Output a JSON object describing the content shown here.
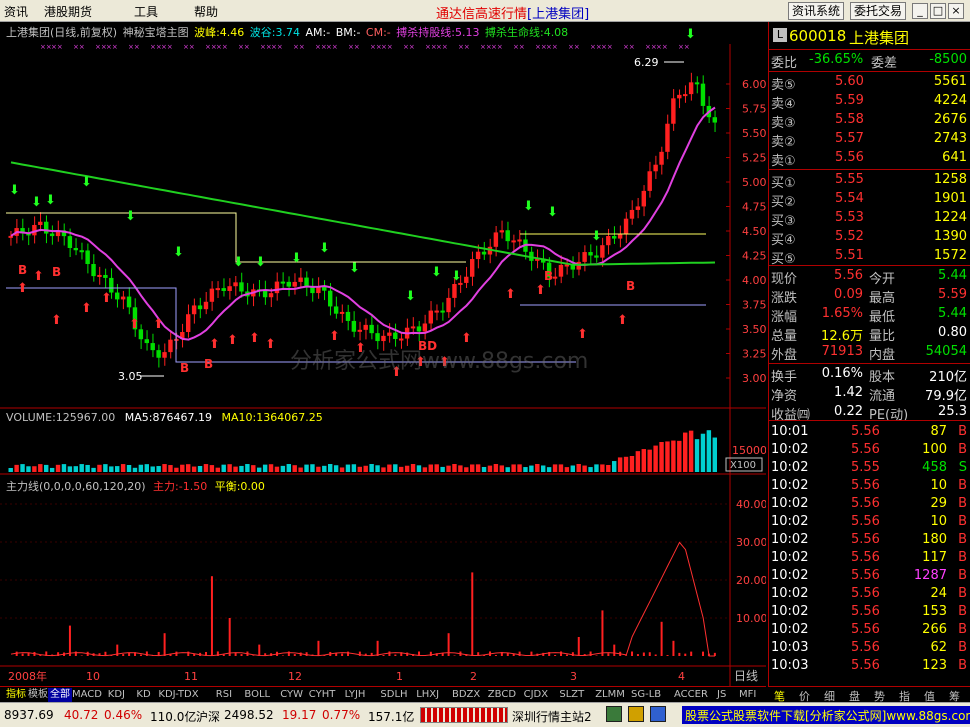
{
  "menu": {
    "items": [
      "资讯",
      "港股期货",
      "工具",
      "帮助"
    ],
    "app_title_prefix": "通达信高速行情",
    "app_title_stock": "[上港集团]",
    "btn_info": "资讯系统",
    "btn_trade": "委托交易"
  },
  "chart_header": {
    "stock": "上港集团(日线,前复权)",
    "indicator": "神秘宝塔主图",
    "peak_label": "波峰:4.46",
    "valley_label": "波谷:3.74",
    "am": "AM:-",
    "bm": "BM:-",
    "cm": "CM:-",
    "hold_line": "搏杀持股线:5.13",
    "life_line": "搏杀生命线:4.08"
  },
  "price_axis": [
    "6.00",
    "5.75",
    "5.50",
    "5.25",
    "5.00",
    "4.75",
    "4.50",
    "4.25",
    "4.00",
    "3.75",
    "3.50",
    "3.25",
    "3.00"
  ],
  "annotations": {
    "high": "6.29",
    "low": "3.05",
    "watermark": "分析家公式网www.88gs.com"
  },
  "volume_header": {
    "label": "VOLUME:125967.00",
    "ma5": "MA5:876467.19",
    "ma10": "MA10:1364067.25"
  },
  "volume_axis": {
    "v": "15000",
    "unit": "X100"
  },
  "main_force_header": {
    "label": "主力线(0,0,0,0,60,120,20)",
    "main": "主力:-1.50",
    "balance": "平衡:0.00"
  },
  "mf_axis": [
    "40.00",
    "30.00",
    "20.00",
    "10.00"
  ],
  "date_axis": [
    "2008年",
    "10",
    "11",
    "12",
    "1",
    "2",
    "3",
    "4"
  ],
  "date_axis_tag": "日线",
  "tabs": [
    "指标",
    "模板",
    "全部",
    "MACD",
    "KDJ",
    "KD",
    "KDJ-TDX",
    "RSI",
    "BOLL",
    "CYW",
    "CYHT",
    "LYJH",
    "SDLH",
    "LHXJ",
    "BDZX",
    "ZBCD",
    "CJDX",
    "SLZT",
    "ZLMM",
    "SG-LB",
    "ACCER",
    "JS",
    "MFI"
  ],
  "quote": {
    "code": "600018",
    "name": "上港集团",
    "wb_label": "委比",
    "wb_value": "-36.65%",
    "wc_label": "委差",
    "wc_value": "-8500",
    "asks": [
      {
        "label": "卖⑤",
        "price": "5.60",
        "vol": "5561"
      },
      {
        "label": "卖④",
        "price": "5.59",
        "vol": "4224"
      },
      {
        "label": "卖③",
        "price": "5.58",
        "vol": "2676"
      },
      {
        "label": "卖②",
        "price": "5.57",
        "vol": "2743"
      },
      {
        "label": "卖①",
        "price": "5.56",
        "vol": "641"
      }
    ],
    "bids": [
      {
        "label": "买①",
        "price": "5.55",
        "vol": "1258"
      },
      {
        "label": "买②",
        "price": "5.54",
        "vol": "1901"
      },
      {
        "label": "买③",
        "price": "5.53",
        "vol": "1224"
      },
      {
        "label": "买④",
        "price": "5.52",
        "vol": "1390"
      },
      {
        "label": "买⑤",
        "price": "5.51",
        "vol": "1572"
      }
    ],
    "stats": [
      {
        "l1": "现价",
        "v1": "5.56",
        "l2": "今开",
        "v2": "5.44",
        "c1": "#ff3030",
        "c2": "#00e000"
      },
      {
        "l1": "涨跌",
        "v1": "0.09",
        "l2": "最高",
        "v2": "5.59",
        "c1": "#ff3030",
        "c2": "#ff3030"
      },
      {
        "l1": "涨幅",
        "v1": "1.65%",
        "l2": "最低",
        "v2": "5.44",
        "c1": "#ff3030",
        "c2": "#00e000"
      },
      {
        "l1": "总量",
        "v1": "12.6万",
        "l2": "量比",
        "v2": "0.80",
        "c1": "#ffff00",
        "c2": "#ffffff"
      },
      {
        "l1": "外盘",
        "v1": "71913",
        "l2": "内盘",
        "v2": "54054",
        "c1": "#ff3030",
        "c2": "#00e000"
      }
    ],
    "fin": [
      {
        "l1": "换手",
        "v1": "0.16%",
        "l2": "股本",
        "v2": "210亿"
      },
      {
        "l1": "净资",
        "v1": "1.42",
        "l2": "流通",
        "v2": "79.9亿"
      },
      {
        "l1": "收益㈣",
        "v1": "0.22",
        "l2": "PE(动)",
        "v2": "25.3"
      }
    ],
    "ticks": [
      {
        "t": "10:01",
        "p": "5.56",
        "v": "87",
        "s": "B"
      },
      {
        "t": "10:02",
        "p": "5.56",
        "v": "100",
        "s": "B"
      },
      {
        "t": "10:02",
        "p": "5.55",
        "v": "458",
        "s": "S"
      },
      {
        "t": "10:02",
        "p": "5.56",
        "v": "10",
        "s": "B"
      },
      {
        "t": "10:02",
        "p": "5.56",
        "v": "29",
        "s": "B"
      },
      {
        "t": "10:02",
        "p": "5.56",
        "v": "10",
        "s": "B"
      },
      {
        "t": "10:02",
        "p": "5.56",
        "v": "180",
        "s": "B"
      },
      {
        "t": "10:02",
        "p": "5.56",
        "v": "117",
        "s": "B"
      },
      {
        "t": "10:02",
        "p": "5.56",
        "v": "1287",
        "s": "B"
      },
      {
        "t": "10:02",
        "p": "5.56",
        "v": "24",
        "s": "B"
      },
      {
        "t": "10:02",
        "p": "5.56",
        "v": "153",
        "s": "B"
      },
      {
        "t": "10:02",
        "p": "5.56",
        "v": "266",
        "s": "B"
      },
      {
        "t": "10:03",
        "p": "5.56",
        "v": "62",
        "s": "B"
      },
      {
        "t": "10:03",
        "p": "5.56",
        "v": "123",
        "s": "B"
      }
    ]
  },
  "rtabs": [
    "笔",
    "价",
    "细",
    "盘",
    "势",
    "指",
    "值",
    "筹"
  ],
  "status": {
    "sh_index": "8937.69",
    "sh_change": "40.72",
    "sh_pct": "0.46%",
    "sh_amount": "110.0亿",
    "sz_label": "沪深",
    "sz_index": "2498.52",
    "sz_change": "19.17",
    "sz_pct": "0.77%",
    "sz_amount": "157.1亿",
    "server": "深圳行情主站2",
    "ad": "股票公式股票软件下载[分析家公式网]www.88gs.com"
  },
  "colors": {
    "up": "#ff3030",
    "down": "#00e000",
    "ma_green": "#20d020",
    "ma_magenta": "#e040e0",
    "accent": "#ffff00"
  }
}
